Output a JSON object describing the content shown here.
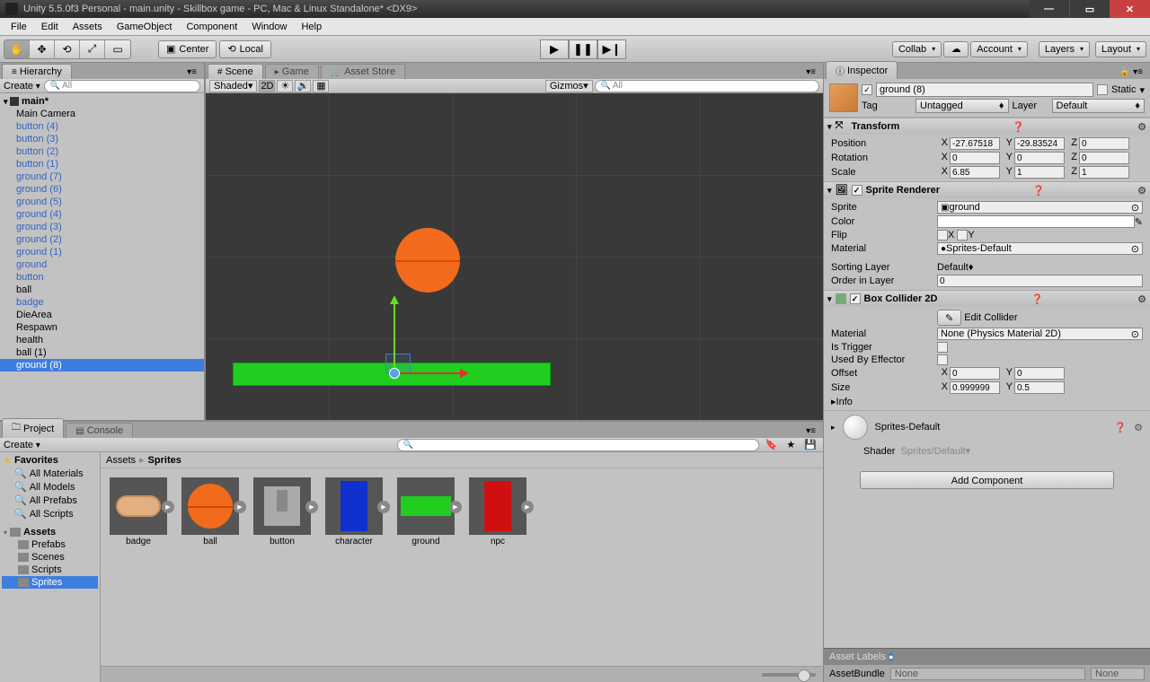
{
  "title": "Unity 5.5.0f3 Personal - main.unity - Skillbox game - PC, Mac & Linux Standalone* <DX9>",
  "menu": [
    "File",
    "Edit",
    "Assets",
    "GameObject",
    "Component",
    "Window",
    "Help"
  ],
  "toolbar": {
    "center": "Center",
    "local": "Local",
    "collab": "Collab",
    "account": "Account",
    "layers": "Layers",
    "layout": "Layout"
  },
  "hierarchy": {
    "title": "Hierarchy",
    "create": "Create",
    "search_ph": "All",
    "root": "main*",
    "items": [
      {
        "label": "Main Camera",
        "c": "black"
      },
      {
        "label": "button (4)"
      },
      {
        "label": "button (3)"
      },
      {
        "label": "button (2)"
      },
      {
        "label": "button (1)"
      },
      {
        "label": "ground (7)"
      },
      {
        "label": "ground (6)"
      },
      {
        "label": "ground (5)"
      },
      {
        "label": "ground (4)"
      },
      {
        "label": "ground (3)"
      },
      {
        "label": "ground (2)"
      },
      {
        "label": "ground (1)"
      },
      {
        "label": "ground"
      },
      {
        "label": "button"
      },
      {
        "label": "ball",
        "c": "black"
      },
      {
        "label": "badge"
      },
      {
        "label": "DieArea",
        "c": "black"
      },
      {
        "label": "Respawn",
        "c": "black"
      },
      {
        "label": "health",
        "c": "black"
      },
      {
        "label": "ball (1)",
        "c": "black"
      },
      {
        "label": "ground (8)",
        "sel": true
      }
    ]
  },
  "scene": {
    "tabs": {
      "scene": "Scene",
      "game": "Game",
      "asset_store": "Asset Store"
    },
    "shading": "Shaded",
    "mode2d": "2D",
    "gizmos": "Gizmos",
    "search_ph": "All"
  },
  "project": {
    "tab": "Project",
    "console": "Console",
    "create": "Create",
    "favorites": "Favorites",
    "fav_items": [
      "All Materials",
      "All Models",
      "All Prefabs",
      "All Scripts"
    ],
    "assets": "Assets",
    "folders": [
      "Prefabs",
      "Scenes",
      "Scripts",
      "Sprites"
    ],
    "selected_folder": "Sprites",
    "breadcrumb": [
      "Assets",
      "Sprites"
    ],
    "items": [
      {
        "name": "badge"
      },
      {
        "name": "ball"
      },
      {
        "name": "button"
      },
      {
        "name": "character"
      },
      {
        "name": "ground"
      },
      {
        "name": "npc"
      }
    ]
  },
  "inspector": {
    "title": "Inspector",
    "name": "ground (8)",
    "static": "Static",
    "tag_label": "Tag",
    "tag": "Untagged",
    "layer_label": "Layer",
    "layer": "Default",
    "transform": {
      "title": "Transform",
      "position": {
        "label": "Position",
        "x": "-27.67518",
        "y": "-29.83524",
        "z": "0"
      },
      "rotation": {
        "label": "Rotation",
        "x": "0",
        "y": "0",
        "z": "0"
      },
      "scale": {
        "label": "Scale",
        "x": "6.85",
        "y": "1",
        "z": "1"
      }
    },
    "sprite_renderer": {
      "title": "Sprite Renderer",
      "sprite_label": "Sprite",
      "sprite": "ground",
      "color_label": "Color",
      "flip_label": "Flip",
      "flip_x": "X",
      "flip_y": "Y",
      "material_label": "Material",
      "material": "Sprites-Default",
      "sorting_label": "Sorting Layer",
      "sorting": "Default",
      "order_label": "Order in Layer",
      "order": "0"
    },
    "box_collider": {
      "title": "Box Collider 2D",
      "edit": "Edit Collider",
      "material_label": "Material",
      "material": "None (Physics Material 2D)",
      "trigger_label": "Is Trigger",
      "effector_label": "Used By Effector",
      "offset_label": "Offset",
      "offset_x": "0",
      "offset_y": "0",
      "size_label": "Size",
      "size_x": "0.999999",
      "size_y": "0.5",
      "info": "Info"
    },
    "material": {
      "name": "Sprites-Default",
      "shader_label": "Shader",
      "shader": "Sprites/Default"
    },
    "add_component": "Add Component",
    "asset_labels": "Asset Labels",
    "assetbundle": "AssetBundle",
    "none": "None"
  }
}
